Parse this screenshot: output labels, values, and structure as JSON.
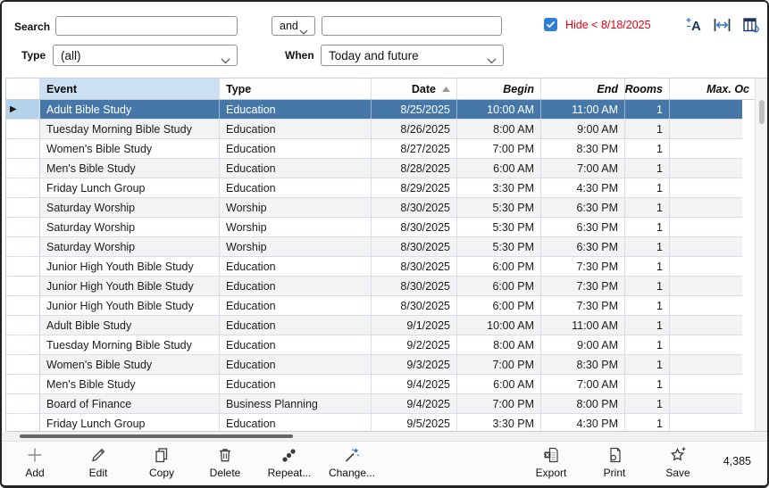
{
  "filter": {
    "search_label": "Search",
    "search_value": "",
    "operator_value": "and",
    "second_search_value": "",
    "type_label": "Type",
    "type_value": "(all)",
    "when_label": "When",
    "when_value": "Today and future",
    "hide_checkbox_label": "Hide < 8/18/2025",
    "hide_checked": true
  },
  "top_icons": {
    "font_size": "font-size-icon",
    "fit_width": "fit-column-width-icon",
    "column_chooser": "column-chooser-icon"
  },
  "table": {
    "columns": [
      {
        "label": "Event"
      },
      {
        "label": "Type"
      },
      {
        "label": "Date",
        "sort": "asc"
      },
      {
        "label": "Begin",
        "italic": true
      },
      {
        "label": "End",
        "italic": true
      },
      {
        "label": "Rooms",
        "italic": true
      },
      {
        "label": "Max. Oc",
        "italic": true
      }
    ],
    "rows": [
      {
        "event": "Adult Bible Study",
        "type": "Education",
        "date": "8/25/2025",
        "begin": "10:00 AM",
        "end": "11:00 AM",
        "rooms": "1",
        "selected": true
      },
      {
        "event": "Tuesday Morning Bible Study",
        "type": "Education",
        "date": "8/26/2025",
        "begin": "8:00 AM",
        "end": "9:00 AM",
        "rooms": "1"
      },
      {
        "event": "Women's Bible Study",
        "type": "Education",
        "date": "8/27/2025",
        "begin": "7:00 PM",
        "end": "8:30 PM",
        "rooms": "1"
      },
      {
        "event": "Men's Bible Study",
        "type": "Education",
        "date": "8/28/2025",
        "begin": "6:00 AM",
        "end": "7:00 AM",
        "rooms": "1"
      },
      {
        "event": "Friday Lunch Group",
        "type": "Education",
        "date": "8/29/2025",
        "begin": "3:30 PM",
        "end": "4:30 PM",
        "rooms": "1"
      },
      {
        "event": "Saturday Worship",
        "type": "Worship",
        "date": "8/30/2025",
        "begin": "5:30 PM",
        "end": "6:30 PM",
        "rooms": "1"
      },
      {
        "event": "Saturday Worship",
        "type": "Worship",
        "date": "8/30/2025",
        "begin": "5:30 PM",
        "end": "6:30 PM",
        "rooms": "1"
      },
      {
        "event": "Saturday Worship",
        "type": "Worship",
        "date": "8/30/2025",
        "begin": "5:30 PM",
        "end": "6:30 PM",
        "rooms": "1"
      },
      {
        "event": "Junior High Youth Bible Study",
        "type": "Education",
        "date": "8/30/2025",
        "begin": "6:00 PM",
        "end": "7:30 PM",
        "rooms": "1"
      },
      {
        "event": "Junior High Youth Bible Study",
        "type": "Education",
        "date": "8/30/2025",
        "begin": "6:00 PM",
        "end": "7:30 PM",
        "rooms": "1"
      },
      {
        "event": "Junior High Youth Bible Study",
        "type": "Education",
        "date": "8/30/2025",
        "begin": "6:00 PM",
        "end": "7:30 PM",
        "rooms": "1"
      },
      {
        "event": "Adult Bible Study",
        "type": "Education",
        "date": "9/1/2025",
        "begin": "10:00 AM",
        "end": "11:00 AM",
        "rooms": "1"
      },
      {
        "event": "Tuesday Morning Bible Study",
        "type": "Education",
        "date": "9/2/2025",
        "begin": "8:00 AM",
        "end": "9:00 AM",
        "rooms": "1"
      },
      {
        "event": "Women's Bible Study",
        "type": "Education",
        "date": "9/3/2025",
        "begin": "7:00 PM",
        "end": "8:30 PM",
        "rooms": "1"
      },
      {
        "event": "Men's Bible Study",
        "type": "Education",
        "date": "9/4/2025",
        "begin": "6:00 AM",
        "end": "7:00 AM",
        "rooms": "1"
      },
      {
        "event": "Board of Finance",
        "type": "Business Planning",
        "date": "9/4/2025",
        "begin": "7:00 PM",
        "end": "8:00 PM",
        "rooms": "1"
      },
      {
        "event": "Friday Lunch Group",
        "type": "Education",
        "date": "9/5/2025",
        "begin": "3:30 PM",
        "end": "4:30 PM",
        "rooms": "1"
      }
    ]
  },
  "toolbar": {
    "buttons": [
      "Add",
      "Edit",
      "Copy",
      "Delete",
      "Repeat...",
      "Change...",
      "Export",
      "Print",
      "Save"
    ],
    "record_count": "4,385"
  },
  "colors": {
    "selection_blue": "#4578A8",
    "selected_gutter_blue": "#B3D3EA",
    "sorted_header_blue": "#CBE0F2",
    "hide_text_red": "#E8000D",
    "checkbox_blue": "#2E7FD4"
  }
}
